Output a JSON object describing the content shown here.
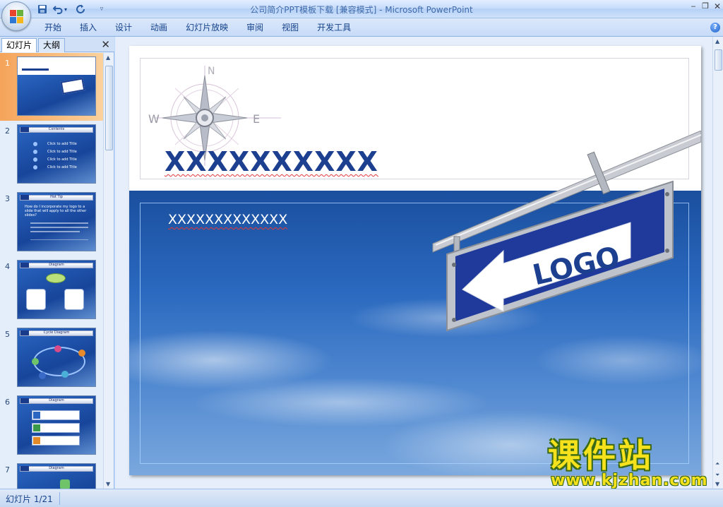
{
  "window": {
    "title": "公司简介PPT模板下载 [兼容模式]",
    "app_name": "Microsoft PowerPoint",
    "separator": " - "
  },
  "quick_access": [
    "save-icon",
    "undo-icon",
    "redo-icon",
    "customize-icon"
  ],
  "ribbon": {
    "tabs": [
      "开始",
      "插入",
      "设计",
      "动画",
      "幻灯片放映",
      "审阅",
      "视图",
      "开发工具"
    ]
  },
  "left_panel": {
    "tab_slides": "幻灯片",
    "tab_outline": "大纲",
    "thumbnails": [
      {
        "num": "1",
        "title": "",
        "selected": true
      },
      {
        "num": "2",
        "title": "Contents"
      },
      {
        "num": "3",
        "title": "Hot Tip"
      },
      {
        "num": "4",
        "title": "Diagram"
      },
      {
        "num": "5",
        "title": "Cycle Diagram"
      },
      {
        "num": "6",
        "title": "Diagram"
      },
      {
        "num": "7",
        "title": "Diagram"
      }
    ],
    "thumb2_items": [
      "Click to add Title",
      "Click to add Title",
      "Click to add Title",
      "Click to add Title"
    ],
    "thumb3_text": "How do I incorporate my logo to a slide that will apply to all the other slides?"
  },
  "slide": {
    "title": "XXXXXXXXXX",
    "subtitle": "XXXXXXXXXXXXX",
    "logo_text": "LOGO",
    "compass": {
      "north": "N",
      "west": "W",
      "east": "E"
    }
  },
  "status": {
    "slide_indicator": "幻灯片 1/21"
  },
  "watermark": {
    "title": "课件站",
    "url": "www.kjzhan.com"
  },
  "colors": {
    "ribbon_bg": "#c7dbf8",
    "title_blue": "#1d3f8f",
    "sky_blue": "#2a69bf",
    "selected_thumb": "#f5a45a",
    "watermark_yellow": "#f6e21c"
  }
}
